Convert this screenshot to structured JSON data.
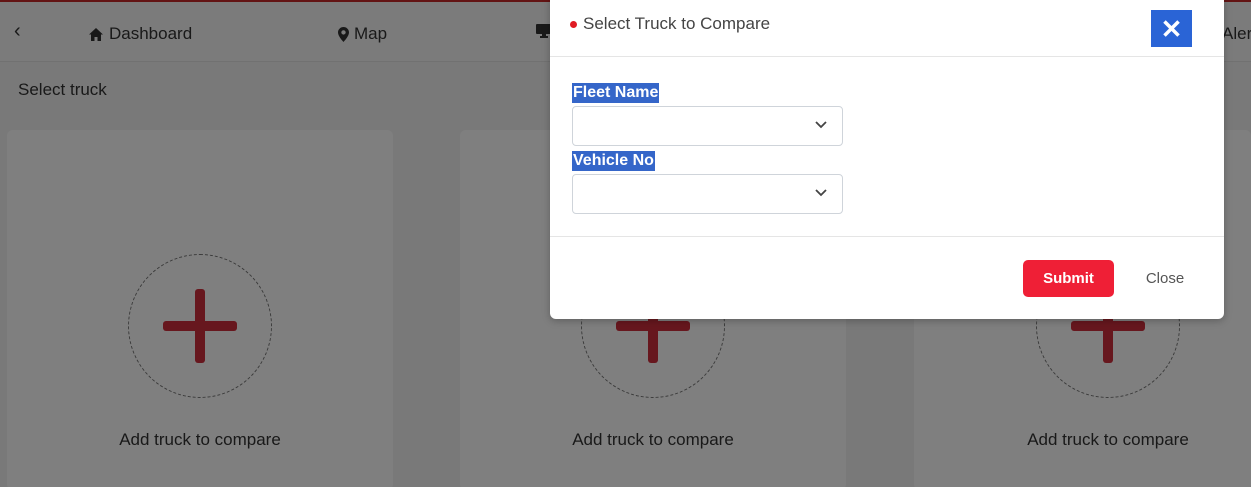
{
  "topbar": {
    "items": [
      {
        "label": "Dashboard",
        "icon": "home-icon"
      },
      {
        "label": "Map",
        "icon": "map-pin-icon"
      },
      {
        "label": "Aler",
        "icon": "monitor-icon"
      }
    ]
  },
  "page": {
    "subtitle": "Select truck",
    "cards": [
      {
        "label": "Add truck to compare"
      },
      {
        "label": "Add truck to compare"
      },
      {
        "label": "Add truck to compare"
      }
    ]
  },
  "modal": {
    "title": "Select Truck to Compare",
    "close_symbol": "✕",
    "fleet_label": "Fleet Name",
    "fleet_value": "",
    "vehicle_label": "Vehicle No",
    "vehicle_value": "",
    "submit_label": "Submit",
    "close_label": "Close"
  },
  "colors": {
    "accent_red": "#ef1f36",
    "plus_red": "#cf2e3d",
    "close_blue": "#2a64d6",
    "highlight_blue": "#3566c9"
  }
}
